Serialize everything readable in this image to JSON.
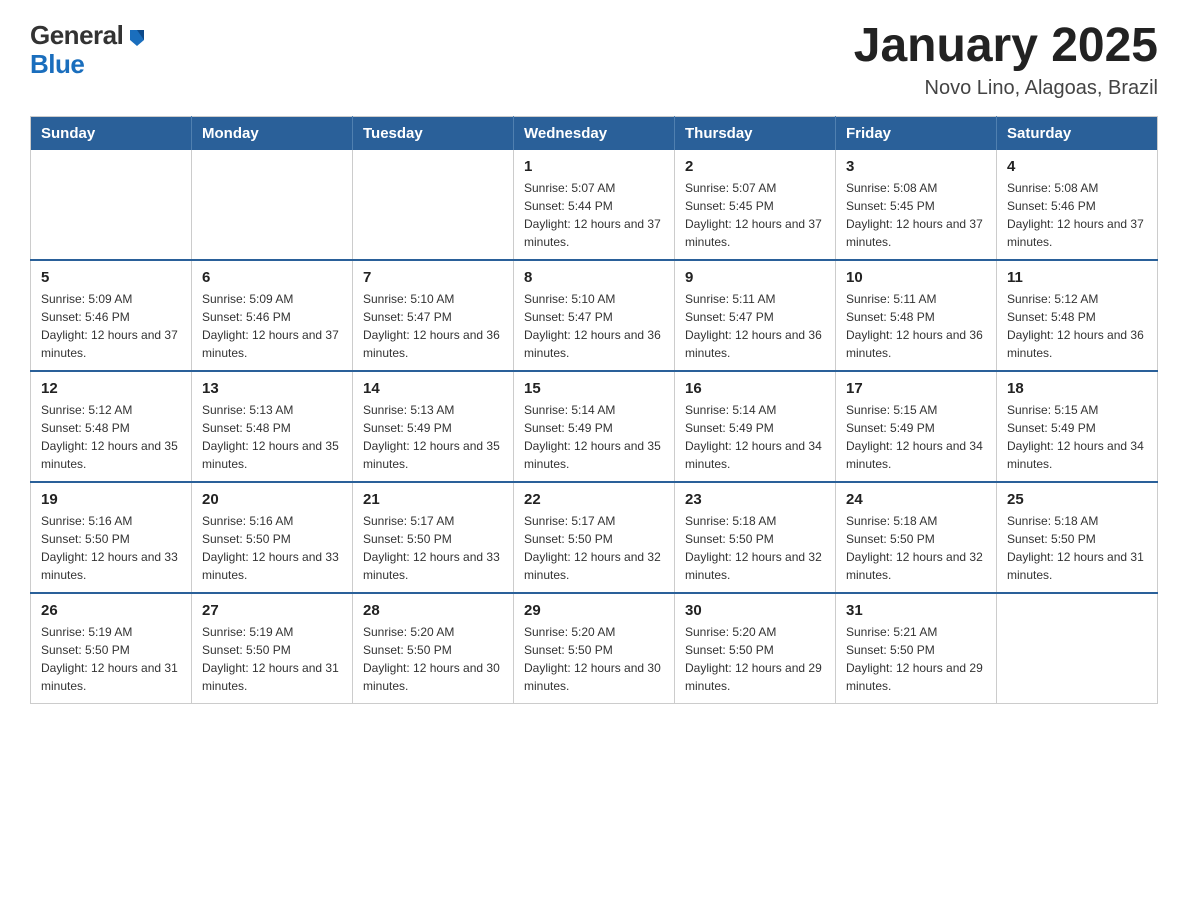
{
  "header": {
    "logo_general": "General",
    "logo_blue": "Blue",
    "title": "January 2025",
    "subtitle": "Novo Lino, Alagoas, Brazil"
  },
  "calendar": {
    "days_of_week": [
      "Sunday",
      "Monday",
      "Tuesday",
      "Wednesday",
      "Thursday",
      "Friday",
      "Saturday"
    ],
    "weeks": [
      [
        {
          "day": "",
          "info": ""
        },
        {
          "day": "",
          "info": ""
        },
        {
          "day": "",
          "info": ""
        },
        {
          "day": "1",
          "info": "Sunrise: 5:07 AM\nSunset: 5:44 PM\nDaylight: 12 hours and 37 minutes."
        },
        {
          "day": "2",
          "info": "Sunrise: 5:07 AM\nSunset: 5:45 PM\nDaylight: 12 hours and 37 minutes."
        },
        {
          "day": "3",
          "info": "Sunrise: 5:08 AM\nSunset: 5:45 PM\nDaylight: 12 hours and 37 minutes."
        },
        {
          "day": "4",
          "info": "Sunrise: 5:08 AM\nSunset: 5:46 PM\nDaylight: 12 hours and 37 minutes."
        }
      ],
      [
        {
          "day": "5",
          "info": "Sunrise: 5:09 AM\nSunset: 5:46 PM\nDaylight: 12 hours and 37 minutes."
        },
        {
          "day": "6",
          "info": "Sunrise: 5:09 AM\nSunset: 5:46 PM\nDaylight: 12 hours and 37 minutes."
        },
        {
          "day": "7",
          "info": "Sunrise: 5:10 AM\nSunset: 5:47 PM\nDaylight: 12 hours and 36 minutes."
        },
        {
          "day": "8",
          "info": "Sunrise: 5:10 AM\nSunset: 5:47 PM\nDaylight: 12 hours and 36 minutes."
        },
        {
          "day": "9",
          "info": "Sunrise: 5:11 AM\nSunset: 5:47 PM\nDaylight: 12 hours and 36 minutes."
        },
        {
          "day": "10",
          "info": "Sunrise: 5:11 AM\nSunset: 5:48 PM\nDaylight: 12 hours and 36 minutes."
        },
        {
          "day": "11",
          "info": "Sunrise: 5:12 AM\nSunset: 5:48 PM\nDaylight: 12 hours and 36 minutes."
        }
      ],
      [
        {
          "day": "12",
          "info": "Sunrise: 5:12 AM\nSunset: 5:48 PM\nDaylight: 12 hours and 35 minutes."
        },
        {
          "day": "13",
          "info": "Sunrise: 5:13 AM\nSunset: 5:48 PM\nDaylight: 12 hours and 35 minutes."
        },
        {
          "day": "14",
          "info": "Sunrise: 5:13 AM\nSunset: 5:49 PM\nDaylight: 12 hours and 35 minutes."
        },
        {
          "day": "15",
          "info": "Sunrise: 5:14 AM\nSunset: 5:49 PM\nDaylight: 12 hours and 35 minutes."
        },
        {
          "day": "16",
          "info": "Sunrise: 5:14 AM\nSunset: 5:49 PM\nDaylight: 12 hours and 34 minutes."
        },
        {
          "day": "17",
          "info": "Sunrise: 5:15 AM\nSunset: 5:49 PM\nDaylight: 12 hours and 34 minutes."
        },
        {
          "day": "18",
          "info": "Sunrise: 5:15 AM\nSunset: 5:49 PM\nDaylight: 12 hours and 34 minutes."
        }
      ],
      [
        {
          "day": "19",
          "info": "Sunrise: 5:16 AM\nSunset: 5:50 PM\nDaylight: 12 hours and 33 minutes."
        },
        {
          "day": "20",
          "info": "Sunrise: 5:16 AM\nSunset: 5:50 PM\nDaylight: 12 hours and 33 minutes."
        },
        {
          "day": "21",
          "info": "Sunrise: 5:17 AM\nSunset: 5:50 PM\nDaylight: 12 hours and 33 minutes."
        },
        {
          "day": "22",
          "info": "Sunrise: 5:17 AM\nSunset: 5:50 PM\nDaylight: 12 hours and 32 minutes."
        },
        {
          "day": "23",
          "info": "Sunrise: 5:18 AM\nSunset: 5:50 PM\nDaylight: 12 hours and 32 minutes."
        },
        {
          "day": "24",
          "info": "Sunrise: 5:18 AM\nSunset: 5:50 PM\nDaylight: 12 hours and 32 minutes."
        },
        {
          "day": "25",
          "info": "Sunrise: 5:18 AM\nSunset: 5:50 PM\nDaylight: 12 hours and 31 minutes."
        }
      ],
      [
        {
          "day": "26",
          "info": "Sunrise: 5:19 AM\nSunset: 5:50 PM\nDaylight: 12 hours and 31 minutes."
        },
        {
          "day": "27",
          "info": "Sunrise: 5:19 AM\nSunset: 5:50 PM\nDaylight: 12 hours and 31 minutes."
        },
        {
          "day": "28",
          "info": "Sunrise: 5:20 AM\nSunset: 5:50 PM\nDaylight: 12 hours and 30 minutes."
        },
        {
          "day": "29",
          "info": "Sunrise: 5:20 AM\nSunset: 5:50 PM\nDaylight: 12 hours and 30 minutes."
        },
        {
          "day": "30",
          "info": "Sunrise: 5:20 AM\nSunset: 5:50 PM\nDaylight: 12 hours and 29 minutes."
        },
        {
          "day": "31",
          "info": "Sunrise: 5:21 AM\nSunset: 5:50 PM\nDaylight: 12 hours and 29 minutes."
        },
        {
          "day": "",
          "info": ""
        }
      ]
    ]
  }
}
